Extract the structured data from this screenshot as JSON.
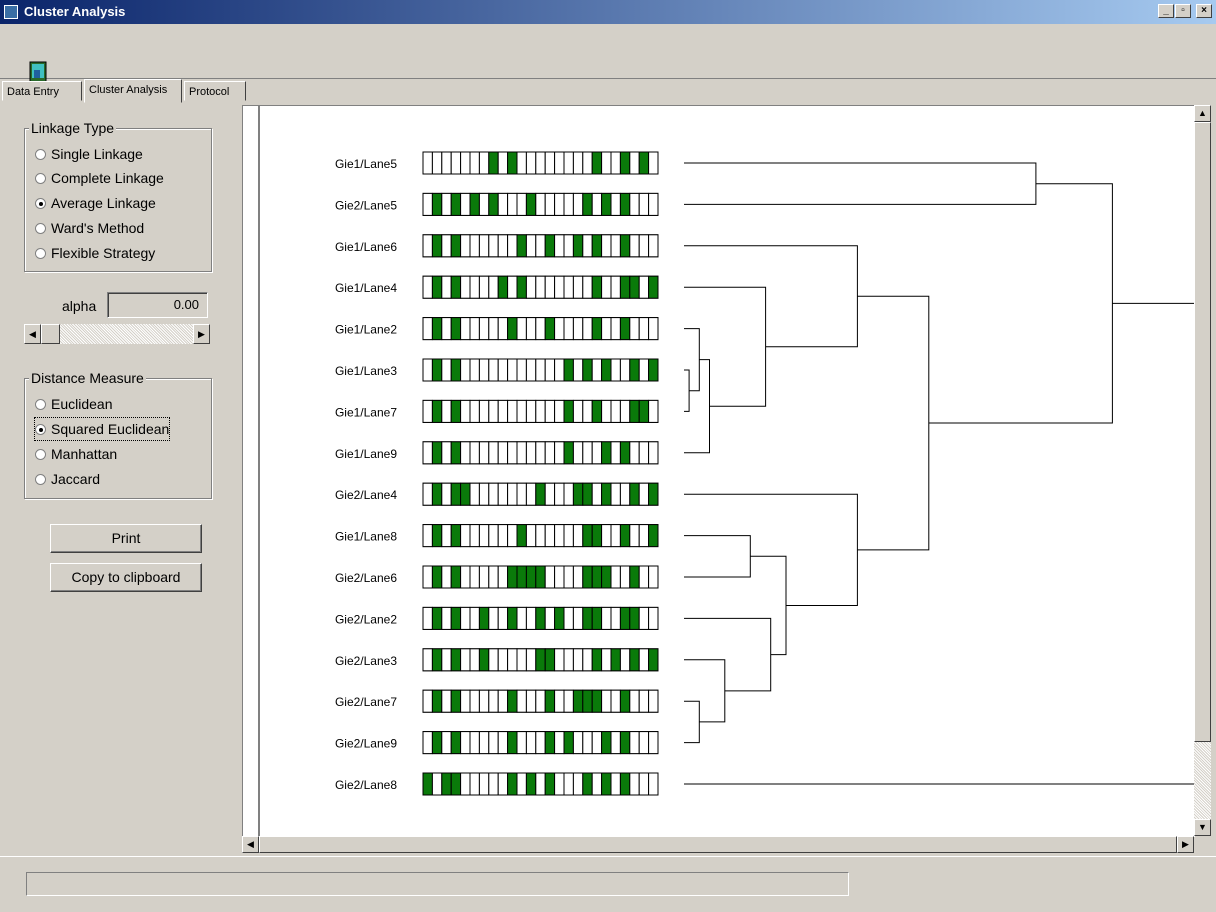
{
  "window": {
    "title": "Cluster Analysis"
  },
  "window_controls": {
    "minimize": "_",
    "maximize": "▫",
    "close": "×"
  },
  "toolbar": {
    "icon": "exit-door-icon"
  },
  "tabs": [
    {
      "label": "Data Entry",
      "active": false
    },
    {
      "label": "Cluster Analysis",
      "active": true
    },
    {
      "label": "Protocol",
      "active": false
    }
  ],
  "linkage": {
    "legend": "Linkage Type",
    "options": [
      "Single Linkage",
      "Complete Linkage",
      "Average Linkage",
      "Ward's Method",
      "Flexible Strategy"
    ],
    "selected": "Average Linkage"
  },
  "alpha": {
    "label": "alpha",
    "value": "0.00"
  },
  "distance": {
    "legend": "Distance Measure",
    "options": [
      "Euclidean",
      "Squared Euclidean",
      "Manhattan",
      "Jaccard"
    ],
    "selected": "Squared Euclidean"
  },
  "buttons": {
    "print": "Print",
    "copy": "Copy to clipboard"
  },
  "colors": {
    "band": "#0a7a0a",
    "title_start": "#0a246a",
    "title_end": "#a6caf0"
  },
  "dendrogram": {
    "lanes": [
      {
        "label": "Gie1/Lane5",
        "bands": "0000000101000000001001010"
      },
      {
        "label": "Gie2/Lane5",
        "bands": "0101010100010000010101000"
      },
      {
        "label": "Gie1/Lane6",
        "bands": "0101000000100100101001000"
      },
      {
        "label": "Gie1/Lane4",
        "bands": "0101000010100000001001101"
      },
      {
        "label": "Gie1/Lane2",
        "bands": "0101000001000100001001000"
      },
      {
        "label": "Gie1/Lane3",
        "bands": "0101000000000001010100101"
      },
      {
        "label": "Gie1/Lane7",
        "bands": "0101000000000001001000110"
      },
      {
        "label": "Gie1/Lane9",
        "bands": "0101000000000001000101000"
      },
      {
        "label": "Gie2/Lane4",
        "bands": "0101100000001000110100101"
      },
      {
        "label": "Gie1/Lane8",
        "bands": "0101000000100000011001001"
      },
      {
        "label": "Gie2/Lane6",
        "bands": "0101000001111000011100100"
      },
      {
        "label": "Gie2/Lane2",
        "bands": "0101001001001010011001100"
      },
      {
        "label": "Gie2/Lane3",
        "bands": "0101001000001100001010101"
      },
      {
        "label": "Gie2/Lane7",
        "bands": "0101000001000100111001000"
      },
      {
        "label": "Gie2/Lane9",
        "bands": "0101000001000101000101000"
      },
      {
        "label": "Gie2/Lane8",
        "bands": "1011000001010100010101000"
      }
    ],
    "merges": [
      {
        "a": 5,
        "b": 6,
        "height": 0.01
      },
      {
        "a": 4,
        "b": 16,
        "height": 0.03
      },
      {
        "a": 7,
        "b": 17,
        "height": 0.05
      },
      {
        "a": 13,
        "b": 14,
        "height": 0.03
      },
      {
        "a": 12,
        "b": 19,
        "height": 0.08
      },
      {
        "a": 9,
        "b": 10,
        "height": 0.13
      },
      {
        "a": 11,
        "b": 20,
        "height": 0.17
      },
      {
        "a": 21,
        "b": 22,
        "height": 0.2
      },
      {
        "a": 8,
        "b": 23,
        "height": 0.34
      },
      {
        "a": 3,
        "b": 18,
        "height": 0.16
      },
      {
        "a": 2,
        "b": 25,
        "height": 0.34
      },
      {
        "a": 26,
        "b": 24,
        "height": 0.48
      },
      {
        "a": 0,
        "b": 1,
        "height": 0.69
      },
      {
        "a": 28,
        "b": 27,
        "height": 0.84
      },
      {
        "a": 29,
        "b": 15,
        "height": 1.19
      }
    ]
  }
}
